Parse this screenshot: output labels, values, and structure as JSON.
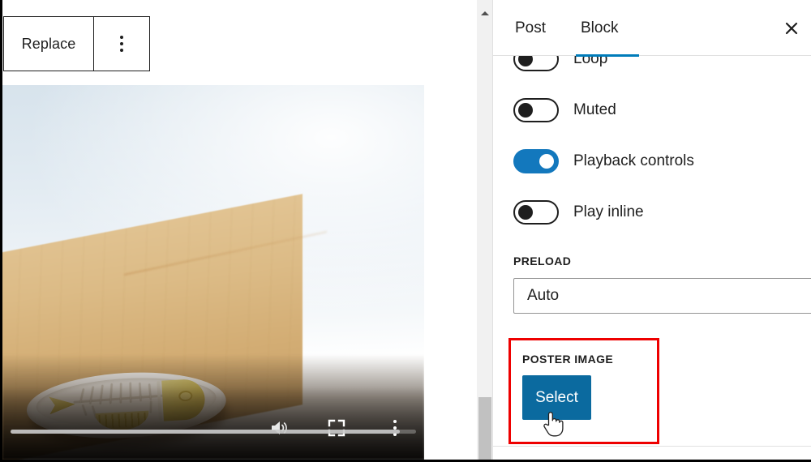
{
  "editor": {
    "block_toolbar": {
      "replace_label": "Replace",
      "more_options_icon": "kebab-vertical-icon",
      "more_options_label": "Options"
    },
    "video_block": {
      "scene_description": "White oval fish-skeleton silicone mold on a light wooden table with soft blue-white background",
      "controls": {
        "volume_icon": "volume-icon",
        "fullscreen_icon": "fullscreen-icon",
        "more_icon": "kebab-vertical-icon",
        "progress_percent": 96
      }
    }
  },
  "scrollbar": {
    "up_arrow_icon": "triangle-up-icon",
    "thumb_label": "scroll-thumb"
  },
  "settings_panel": {
    "header": {
      "tabs": [
        {
          "label": "Post",
          "active": false
        },
        {
          "label": "Block",
          "active": true
        }
      ],
      "close_icon": "close-icon",
      "close_label": "Close settings"
    },
    "toggles": [
      {
        "label": "Loop",
        "state": "off"
      },
      {
        "label": "Muted",
        "state": "off"
      },
      {
        "label": "Playback controls",
        "state": "on"
      },
      {
        "label": "Play inline",
        "state": "off"
      }
    ],
    "preload": {
      "label": "PRELOAD",
      "value": "Auto",
      "chevron_icon": "chevron-down-icon"
    },
    "poster_image": {
      "label": "POSTER IMAGE",
      "select_label": "Select",
      "highlight_color": "#ee0000"
    }
  },
  "colors": {
    "accent_blue": "#007cba",
    "toggle_on_blue": "#1378bd",
    "button_blue": "#0b6a9f",
    "highlight_red": "#ee0000",
    "text": "#1e1e1e",
    "border": "#e0e0e0"
  },
  "cursor": {
    "type": "pointer-hand-cursor"
  }
}
